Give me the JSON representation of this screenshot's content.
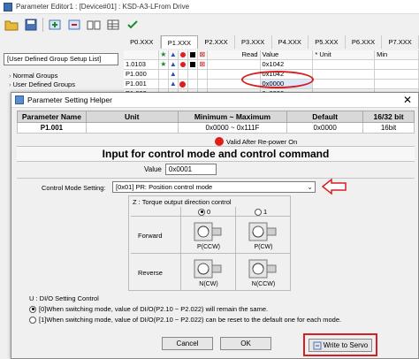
{
  "editor": {
    "title": "Parameter Editor1 : [Device#01] : KSD-A3-LFrom Drive",
    "group_select": "[User Defined Group Setup List]",
    "tree": [
      "Normal Groups",
      "User Defined Groups"
    ],
    "tabs": [
      "P0.XXX",
      "P1.XXX",
      "P2.XXX",
      "P3.XXX",
      "P4.XXX",
      "P5.XXX",
      "P6.XXX",
      "P7.XXX"
    ],
    "grid_headers": {
      "read": "Read",
      "value": "Value",
      "unit": "Unit",
      "min": "Min"
    },
    "rows": [
      {
        "num": "1.0103",
        "value": "0x1042"
      },
      {
        "num": "P1.000",
        "value": "0x1042"
      },
      {
        "num": "P1.001",
        "value": "0x0000"
      },
      {
        "num": "P1.002",
        "value": "0x0000"
      }
    ],
    "colors": {
      "highlight": "#d32020"
    }
  },
  "dialog": {
    "title": "Parameter Setting Helper",
    "close": "✕",
    "table_headers": [
      "Parameter Name",
      "Unit",
      "Minimum ~ Maximum",
      "Default",
      "16/32 bit"
    ],
    "table_row": [
      "P1.001",
      "",
      "0x0000 ~ 0x111F",
      "0x0000",
      "16bit"
    ],
    "valid_note": "Valid After Re-power On",
    "heading": "Input for control mode and control command",
    "value_label": "Value",
    "value": "0x0001",
    "cms_label": "Control Mode Setting:",
    "cms_value": "[0x01] PR: Position control mode",
    "z_label": "Z : Torque output direction control",
    "z_opts": [
      "0",
      "1"
    ],
    "z_rows": [
      "Forward",
      "Reverse"
    ],
    "motor_caps": [
      "P(CCW)",
      "P(CW)",
      "N(CW)",
      "N(CCW)"
    ],
    "u_label": "U : DI/O Setting Control",
    "u_opts": [
      "[0]When switching mode, value of DI/O(P2.10 ~ P2.022) will remain the same.",
      "[1]When switching mode, value of DI/O(P2.10 ~ P2.022) can be reset to the default one for each mode."
    ],
    "cancel": "Cancel",
    "ok": "OK",
    "write": "Write to Servo"
  }
}
